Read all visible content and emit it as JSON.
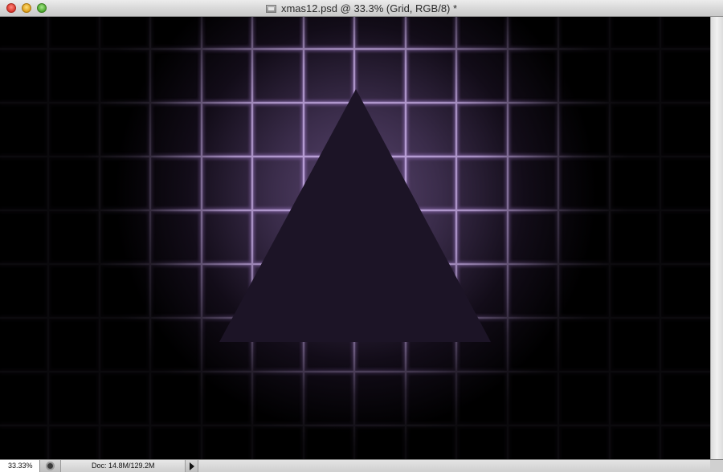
{
  "window": {
    "title": "xmas12.psd @ 33.3% (Grid, RGB/8) *"
  },
  "status": {
    "zoom": "33.33%",
    "doc_info": "Doc: 14.8M/129.2M"
  },
  "colors": {
    "canvas_bg": "#000000",
    "glow_center": "#5a4670",
    "grid_line": "#b89ad6",
    "triangle_fill": "#1c1426"
  },
  "icons": {
    "close": "close-button-icon",
    "minimize": "minimize-button-icon",
    "zoom": "zoom-button-icon",
    "document": "psd-document-icon",
    "status": "status-info-icon",
    "arrow": "play-arrow-icon"
  }
}
